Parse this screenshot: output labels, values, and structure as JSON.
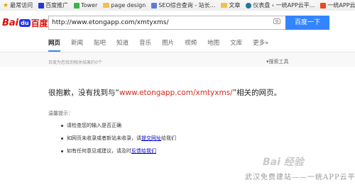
{
  "bookmarks": [
    {
      "label": "最常访问",
      "icon": "star-icon"
    },
    {
      "label": "百度推广",
      "icon": "baidu-icon"
    },
    {
      "label": "Tower",
      "icon": "tower-icon"
    },
    {
      "label": "page design",
      "icon": "folder-icon"
    },
    {
      "label": "SEO综合查询 - 站长...",
      "icon": "seo-icon"
    },
    {
      "label": "文章",
      "icon": "folder-icon"
    },
    {
      "label": "仪表盘 ‹ 一统APP云平...",
      "icon": "wordpress-icon"
    },
    {
      "label": "一统APP云平台",
      "icon": "site-icon"
    }
  ],
  "logo": {
    "bai": "Bai",
    "du": "du",
    "cn": "百度"
  },
  "search": {
    "query": "http://www.etongapp.com/xmtyxms/",
    "button": "百度一下"
  },
  "tabs": [
    "网页",
    "新闻",
    "贴吧",
    "知道",
    "音乐",
    "图片",
    "视频",
    "地图",
    "文库",
    "更多»"
  ],
  "result_count": "百度为您找到相关结果约0个",
  "tools": "搜索工具",
  "not_found": {
    "prefix": "很抱歉，没有找到与“",
    "url": "www.etongapp.com/xmtyxms/",
    "suffix": "”相关的网页。"
  },
  "tips": {
    "title": "温馨提示：",
    "items": [
      {
        "text": "请检查您的输入是否正确"
      },
      {
        "text": "如网页未收录或者新站未收录，请",
        "link": "提交网址",
        "after": "给我们"
      },
      {
        "text": "如有任何意见或建议，请及时",
        "link": "反馈给我们",
        "after": ""
      }
    ]
  },
  "watermark": {
    "text": "武汉免费建站——一统APP云平台",
    "logo": "Bai 经验"
  }
}
